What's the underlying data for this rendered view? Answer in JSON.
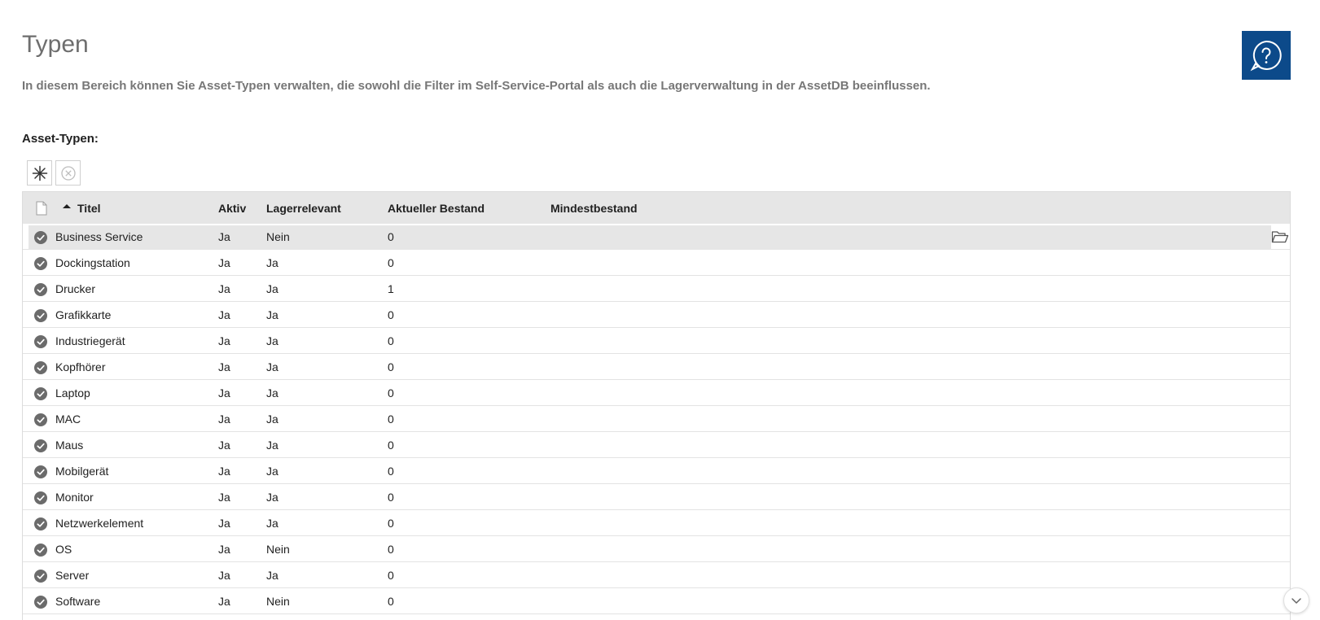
{
  "page": {
    "title": "Typen",
    "description": "In diesem Bereich können Sie Asset-Typen verwalten, die sowohl die Filter im Self-Service-Portal als auch die Lagerverwaltung in der AssetDB beeinflussen.",
    "section_label": "Asset-Typen:"
  },
  "colors": {
    "help_button_bg": "#0c4a8a",
    "header_bg": "#e6e6e6",
    "status_icon": "#6b6b6b"
  },
  "toolbar": {
    "icons": [
      "asterisk-add-icon",
      "cancel-circle-icon"
    ]
  },
  "table": {
    "columns": {
      "select_icon": "document-icon",
      "sort_icon": "sort-ascending-icon",
      "title": "Titel",
      "active": "Aktiv",
      "storage_relevant": "Lagerrelevant",
      "current_stock": "Aktueller Bestand",
      "min_stock": "Mindestbestand"
    },
    "row_icons": {
      "status": "check-circle-icon",
      "open": "folder-open-icon"
    },
    "rows": [
      {
        "title": "Business Service",
        "active": "Ja",
        "storage_relevant": "Nein",
        "current_stock": "0",
        "min_stock": ""
      },
      {
        "title": "Dockingstation",
        "active": "Ja",
        "storage_relevant": "Ja",
        "current_stock": "0",
        "min_stock": ""
      },
      {
        "title": "Drucker",
        "active": "Ja",
        "storage_relevant": "Ja",
        "current_stock": "1",
        "min_stock": ""
      },
      {
        "title": "Grafikkarte",
        "active": "Ja",
        "storage_relevant": "Ja",
        "current_stock": "0",
        "min_stock": ""
      },
      {
        "title": "Industriegerät",
        "active": "Ja",
        "storage_relevant": "Ja",
        "current_stock": "0",
        "min_stock": ""
      },
      {
        "title": "Kopfhörer",
        "active": "Ja",
        "storage_relevant": "Ja",
        "current_stock": "0",
        "min_stock": ""
      },
      {
        "title": "Laptop",
        "active": "Ja",
        "storage_relevant": "Ja",
        "current_stock": "0",
        "min_stock": ""
      },
      {
        "title": "MAC",
        "active": "Ja",
        "storage_relevant": "Ja",
        "current_stock": "0",
        "min_stock": ""
      },
      {
        "title": "Maus",
        "active": "Ja",
        "storage_relevant": "Ja",
        "current_stock": "0",
        "min_stock": ""
      },
      {
        "title": "Mobilgerät",
        "active": "Ja",
        "storage_relevant": "Ja",
        "current_stock": "0",
        "min_stock": ""
      },
      {
        "title": "Monitor",
        "active": "Ja",
        "storage_relevant": "Ja",
        "current_stock": "0",
        "min_stock": ""
      },
      {
        "title": "Netzwerkelement",
        "active": "Ja",
        "storage_relevant": "Ja",
        "current_stock": "0",
        "min_stock": ""
      },
      {
        "title": "OS",
        "active": "Ja",
        "storage_relevant": "Nein",
        "current_stock": "0",
        "min_stock": ""
      },
      {
        "title": "Server",
        "active": "Ja",
        "storage_relevant": "Ja",
        "current_stock": "0",
        "min_stock": ""
      },
      {
        "title": "Software",
        "active": "Ja",
        "storage_relevant": "Nein",
        "current_stock": "0",
        "min_stock": ""
      }
    ]
  },
  "floating": {
    "help_icon": "help-chat-icon",
    "scroll_icon": "chevron-down-icon"
  }
}
